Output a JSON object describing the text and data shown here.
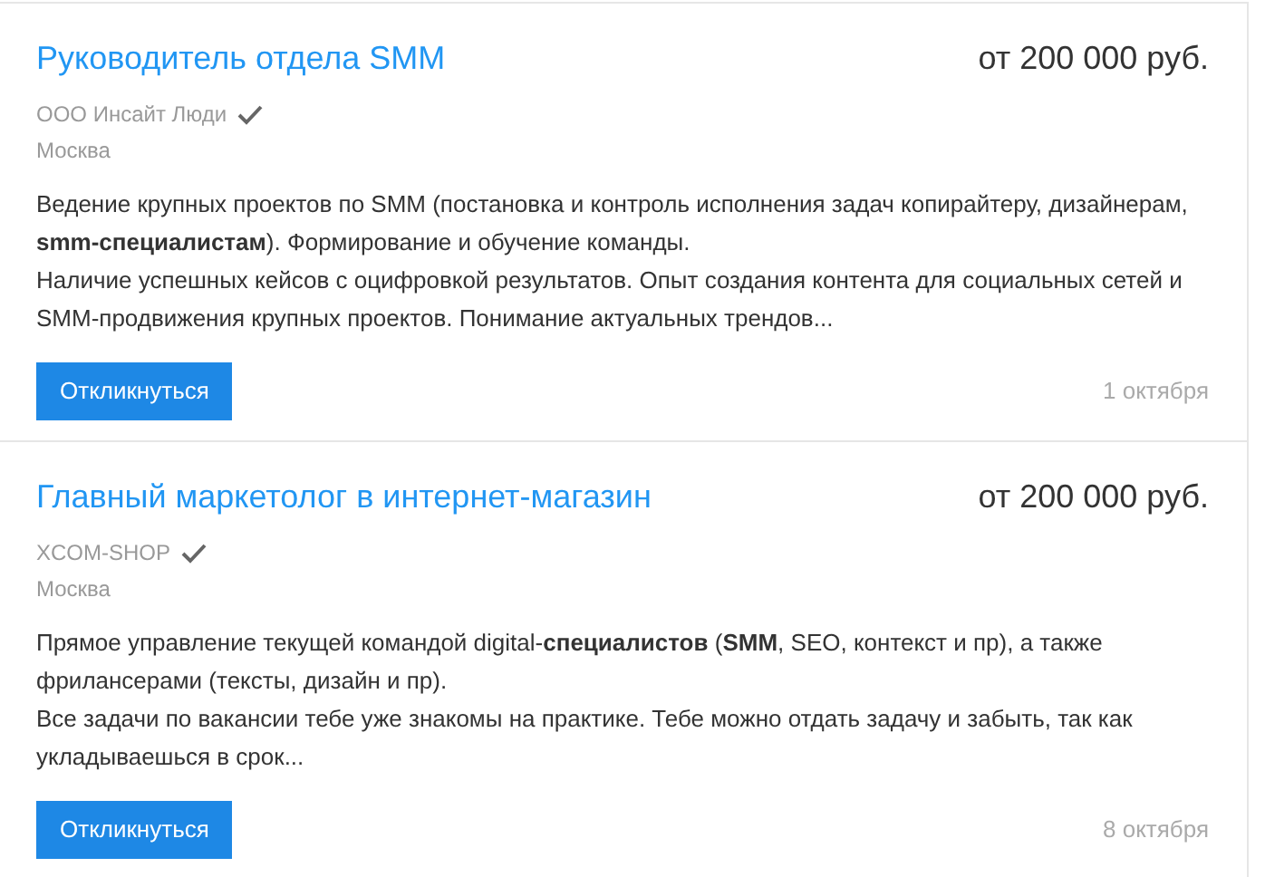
{
  "vacancies": [
    {
      "title": "Руководитель отдела SMM",
      "salary": "от 200 000 руб.",
      "company": "ООО Инсайт Люди",
      "verified": true,
      "city": "Москва",
      "description": [
        "Ведение крупных проектов по SMM (постановка и контроль исполнения задач копирайтеру, дизайнерам, **smm-специалистам**). Формирование и обучение команды.",
        "Наличие успешных кейсов с оцифровкой результатов. Опыт создания контента для социальных сетей и SMM-продвижения крупных проектов. Понимание актуальных трендов..."
      ],
      "button": "Откликнуться",
      "date": "1 октября"
    },
    {
      "title": "Главный маркетолог в интернет-магазин",
      "salary": "от 200 000 руб.",
      "company": "XCOM-SHOP",
      "verified": true,
      "city": "Москва",
      "description": [
        "Прямое управление текущей командой digital-**специалистов** (**SMM**, SEO, контекст и пр), а также фрилансерами (тексты, дизайн и пр).",
        "Все задачи по вакансии тебе уже знакомы на практике. Тебе можно отдать задачу и забыть, так как укладываешься в срок..."
      ],
      "button": "Откликнуться",
      "date": "8 октября"
    }
  ]
}
